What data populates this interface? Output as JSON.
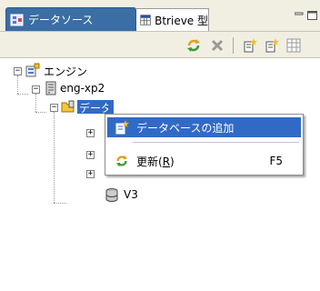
{
  "tabs": [
    {
      "label": "データソース"
    },
    {
      "label": "Btrieve 型"
    }
  ],
  "tree": {
    "root": {
      "label": "エンジン"
    },
    "server": {
      "label": "eng-xp2"
    },
    "databases": {
      "label": "データベース"
    },
    "db_v3": {
      "label": "V3"
    }
  },
  "context_menu": {
    "items": [
      {
        "label": "データベースの追加",
        "shortcut": ""
      },
      {
        "label": "更新(R)",
        "label_main": "更新(",
        "label_mnemonic": "R",
        "label_end": ")",
        "shortcut": "F5"
      }
    ]
  },
  "icons": {
    "tab_datasource": "datasource-icon",
    "tab_btrieve": "table-icon",
    "refresh": "refresh-icon",
    "delete": "delete-icon",
    "add_db": "add-database-icon",
    "new_db": "new-database-icon",
    "grid": "grid-icon"
  },
  "colors": {
    "active_tab": "#3a6ea5",
    "selection": "#316ac5",
    "chrome": "#f1efe2"
  }
}
